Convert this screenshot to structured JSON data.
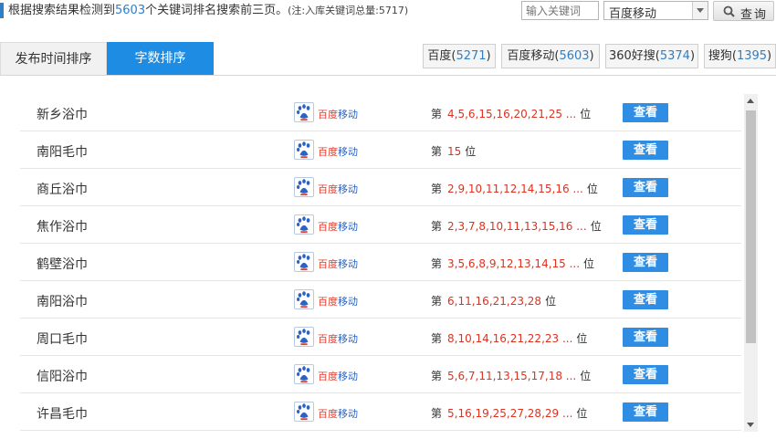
{
  "summary": {
    "prefix": "根据搜索结果检测到",
    "count": "5603",
    "suffix": "个关键词排名搜索前三页。",
    "note": "(注:入库关键词总量:5717)"
  },
  "search": {
    "placeholder": "输入关键词",
    "engine_selected": "百度移动",
    "query_label": "查询"
  },
  "tabs": [
    {
      "label": "发布时间排序",
      "active": false
    },
    {
      "label": "字数排序",
      "active": true
    }
  ],
  "engines": [
    {
      "name": "百度",
      "count": "5271"
    },
    {
      "name": "百度移动",
      "count": "5603"
    },
    {
      "name": "360好搜",
      "count": "5374"
    },
    {
      "name": "搜狗",
      "count": "1395"
    }
  ],
  "rank_prefix": "第",
  "rank_suffix": "位",
  "logo_text_a": "百度",
  "logo_text_b": "移动",
  "rows": [
    {
      "keyword": "新乡浴巾",
      "ranks": "4,5,6,15,16,20,21,25 ...",
      "action": "查看"
    },
    {
      "keyword": "南阳毛巾",
      "ranks": "15",
      "action": "查看"
    },
    {
      "keyword": "商丘浴巾",
      "ranks": "2,9,10,11,12,14,15,16 ...",
      "action": "查看"
    },
    {
      "keyword": "焦作浴巾",
      "ranks": "2,3,7,8,10,11,13,15,16 ...",
      "action": "查看"
    },
    {
      "keyword": "鹤壁浴巾",
      "ranks": "3,5,6,8,9,12,13,14,15 ...",
      "action": "查看"
    },
    {
      "keyword": "南阳浴巾",
      "ranks": "6,11,16,21,23,28",
      "action": "查看"
    },
    {
      "keyword": "周口毛巾",
      "ranks": "8,10,14,16,21,22,23 ...",
      "action": "查看"
    },
    {
      "keyword": "信阳浴巾",
      "ranks": "5,6,7,11,13,15,17,18 ...",
      "action": "查看"
    },
    {
      "keyword": "许昌毛巾",
      "ranks": "5,16,19,25,27,28,29 ...",
      "action": "查看"
    }
  ],
  "colors": {
    "accent": "#1f8ce3",
    "rank_red": "#e0311f",
    "count_blue": "#2f7ec6"
  }
}
